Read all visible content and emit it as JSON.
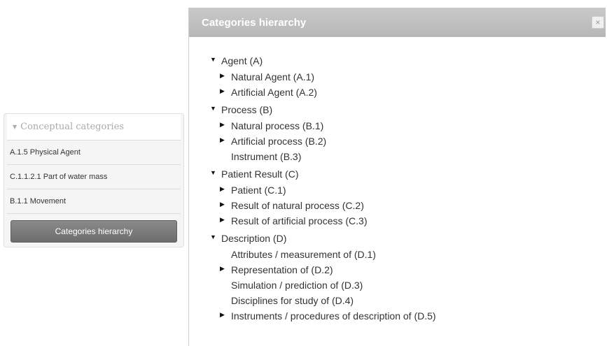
{
  "sidebar": {
    "header": "Conceptual categories",
    "items": [
      {
        "label": "A.1.5 Physical Agent"
      },
      {
        "label": "C.1.1.2.1 Part of water mass"
      },
      {
        "label": "B.1.1 Movement"
      }
    ],
    "button_label": "Categories hierarchy"
  },
  "dialog": {
    "title": "Categories hierarchy",
    "close_symbol": "×",
    "tree": [
      {
        "label": "Agent (A)",
        "expanded": true,
        "children": [
          {
            "label": "Natural Agent (A.1)",
            "has_children": true
          },
          {
            "label": "Artificial Agent (A.2)",
            "has_children": true
          }
        ]
      },
      {
        "label": "Process (B)",
        "expanded": true,
        "children": [
          {
            "label": "Natural process (B.1)",
            "has_children": true
          },
          {
            "label": "Artificial process (B.2)",
            "has_children": true
          },
          {
            "label": "Instrument (B.3)",
            "has_children": false
          }
        ]
      },
      {
        "label": "Patient Result (C)",
        "expanded": true,
        "children": [
          {
            "label": "Patient (C.1)",
            "has_children": true
          },
          {
            "label": "Result of natural process (C.2)",
            "has_children": true
          },
          {
            "label": "Result of artificial process (C.3)",
            "has_children": true
          }
        ]
      },
      {
        "label": "Description (D)",
        "expanded": true,
        "children": [
          {
            "label": "Attributes / measurement of (D.1)",
            "has_children": false
          },
          {
            "label": "Representation of (D.2)",
            "has_children": true
          },
          {
            "label": "Simulation / prediction of (D.3)",
            "has_children": false
          },
          {
            "label": "Disciplines for study of (D.4)",
            "has_children": false
          },
          {
            "label": "Instruments / procedures of description of (D.5)",
            "has_children": true
          }
        ]
      }
    ]
  }
}
